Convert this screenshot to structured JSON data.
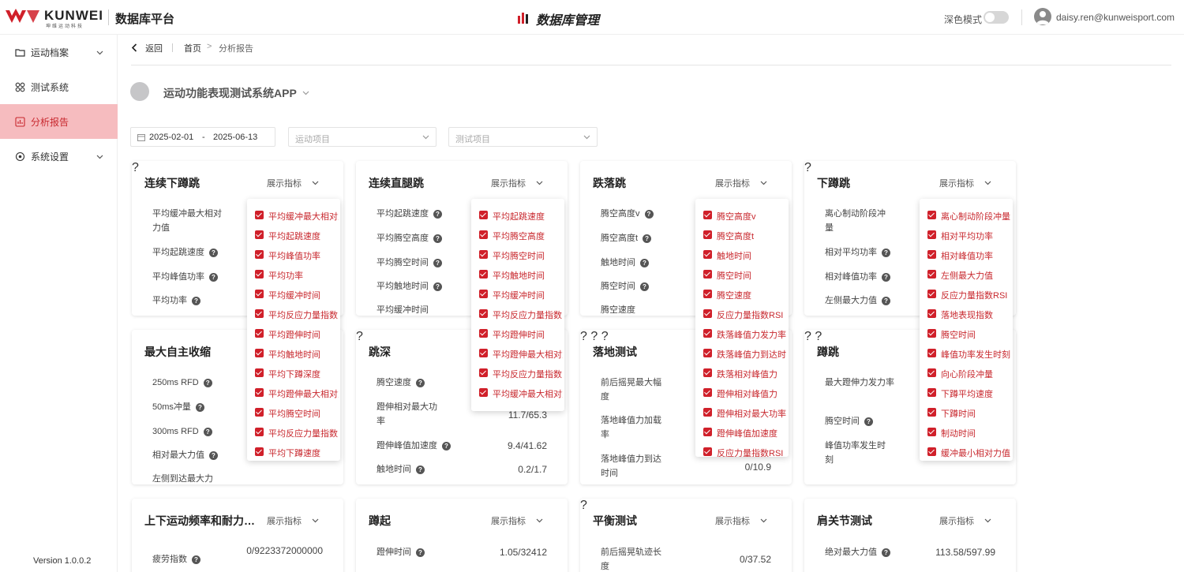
{
  "header": {
    "logo_text": "KUNWEI",
    "logo_sub": "坤维运动科技",
    "platform": "数据库平台",
    "center_title": "数据库管理",
    "dark_mode_label": "深色模式",
    "user_email": "daisy.ren@kunweisport.com"
  },
  "sidebar": {
    "items": [
      {
        "label": "运动档案",
        "icon": "folder-icon"
      },
      {
        "label": "测试系统",
        "icon": "grid-icon"
      },
      {
        "label": "分析报告",
        "icon": "chart-icon"
      },
      {
        "label": "系统设置",
        "icon": "settings-icon"
      }
    ],
    "version": "Version 1.0.0.2"
  },
  "breadcrumb": {
    "back": "返回",
    "home": "首页",
    "current": "分析报告"
  },
  "app": {
    "name": "运动功能表现测试系统APP"
  },
  "filters": {
    "date_start": "2025-02-01",
    "date_end": "2025-06-13",
    "sport_placeholder": "运动项目",
    "test_placeholder": "测试项目"
  },
  "show_indicators_label": "展示指标",
  "cards": [
    {
      "title": "连续下蹲跳",
      "metrics": [
        "平均缓冲最大相对力值",
        "平均起跳速度",
        "平均峰值功率",
        "平均功率",
        "平均缓冲时间"
      ]
    },
    {
      "title": "连续直腿跳",
      "metrics": [
        "平均起跳速度",
        "平均腾空高度",
        "平均腾空时间",
        "平均触地时间",
        "平均缓冲时间"
      ]
    },
    {
      "title": "跌落跳",
      "metrics": [
        "腾空高度v",
        "腾空高度t",
        "触地时间",
        "腾空时间",
        "腾空速度"
      ]
    },
    {
      "title": "下蹲跳",
      "metrics": [
        "离心制动阶段冲量",
        "相对平均功率",
        "相对峰值功率",
        "左侧最大力值"
      ]
    },
    {
      "title": "最大自主收缩",
      "metrics": [
        "250ms RFD",
        "50ms冲量",
        "300ms RFD",
        "相对最大力值",
        "左侧到达最大力"
      ]
    },
    {
      "title": "跳深",
      "metrics": [
        "腾空速度",
        "蹬伸相对最大功率",
        "蹬伸峰值加速度",
        "触地时间"
      ],
      "values": [
        "",
        "11.7/65.3",
        "9.4/41.62",
        "0.2/1.7"
      ]
    },
    {
      "title": "落地测试",
      "metrics": [
        "前后摇晃最大幅度",
        "落地峰值力加载率",
        "落地峰值力到达时间"
      ],
      "values": [
        "",
        "",
        "0/10.9"
      ]
    },
    {
      "title": "蹲跳",
      "metrics": [
        "最大蹬伸力发力率",
        "腾空时间",
        "峰值功率发生时刻"
      ]
    },
    {
      "title": "上下运动频率和耐力测试",
      "metrics": [
        "疲劳指数"
      ],
      "values": [
        "0/9223372000000"
      ]
    },
    {
      "title": "蹲起",
      "metrics": [
        "蹬伸时间"
      ],
      "values": [
        "1.05/32412"
      ]
    },
    {
      "title": "平衡测试",
      "metrics": [
        "前后摇晃轨迹长度"
      ],
      "values": [
        "0/37.52"
      ]
    },
    {
      "title": "肩关节测试",
      "metrics": [
        "绝对最大力值"
      ],
      "values": [
        "113.58/597.99"
      ]
    }
  ],
  "dropdowns": [
    {
      "items": [
        "平均缓冲最大相对力值",
        "平均起跳速度",
        "平均峰值功率",
        "平均功率",
        "平均缓冲时间",
        "平均反应力量指数",
        "平均蹬伸时间",
        "平均触地时间",
        "平均下蹲深度",
        "平均蹬伸最大相对力值",
        "平均腾空时间",
        "平均反应力量指数",
        "平均下蹲速度"
      ]
    },
    {
      "items": [
        "平均起跳速度",
        "平均腾空高度",
        "平均腾空时间",
        "平均触地时间",
        "平均缓冲时间",
        "平均反应力量指数",
        "平均蹬伸时间",
        "平均蹬伸最大相对力值",
        "平均反应力量指数",
        "平均缓冲最大相对力值"
      ]
    },
    {
      "items": [
        "腾空高度v",
        "腾空高度t",
        "触地时间",
        "腾空时间",
        "腾空速度",
        "反应力量指数RSI",
        "跌落峰值力发力率",
        "跌落峰值力到达时间",
        "跌落相对峰值力",
        "蹬伸相对峰值力",
        "蹬伸相对最大功率",
        "蹬伸峰值加速度",
        "反应力量指数RSI"
      ]
    },
    {
      "items": [
        "离心制动阶段冲量",
        "相对平均功率",
        "相对峰值功率",
        "左侧最大力值",
        "反应力量指数RSI",
        "落地表现指数",
        "腾空时间",
        "峰值功率发生时刻",
        "向心阶段冲量",
        "下蹲平均速度",
        "下蹲时间",
        "制动时间",
        "缓冲最小相对力值"
      ]
    }
  ]
}
